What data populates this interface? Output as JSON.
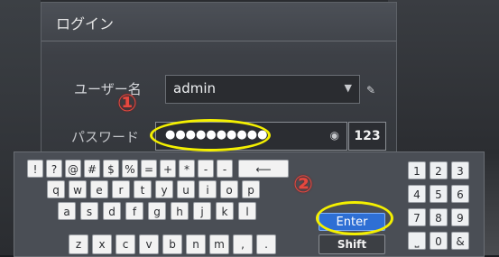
{
  "dialog": {
    "title": "ログイン",
    "username_label": "ユーザー名",
    "username_value": "admin",
    "password_label": "パスワード",
    "password_value": "●●●●●●●●●●",
    "numeric_toggle": "123"
  },
  "keyboard": {
    "row1": [
      "!",
      "?",
      "@",
      "#",
      "$",
      "%",
      "=",
      "+",
      "*",
      "-",
      "-",
      "⟵"
    ],
    "row2": [
      "q",
      "w",
      "e",
      "r",
      "t",
      "y",
      "u",
      "i",
      "o",
      "p"
    ],
    "row3": [
      "a",
      "s",
      "d",
      "f",
      "g",
      "h",
      "j",
      "k",
      "l"
    ],
    "row4": [
      "z",
      "x",
      "c",
      "v",
      "b",
      "n",
      "m",
      ",",
      "."
    ],
    "enter_label": "Enter",
    "shift_label": "Shift",
    "numpad": [
      "1",
      "2",
      "3",
      "4",
      "5",
      "6",
      "7",
      "8",
      "9",
      "⎵",
      "0",
      "&"
    ]
  },
  "annotations": {
    "marker1": "①",
    "marker2": "②",
    "highlight_color": "#f4f000",
    "marker_color": "#e4483f"
  }
}
